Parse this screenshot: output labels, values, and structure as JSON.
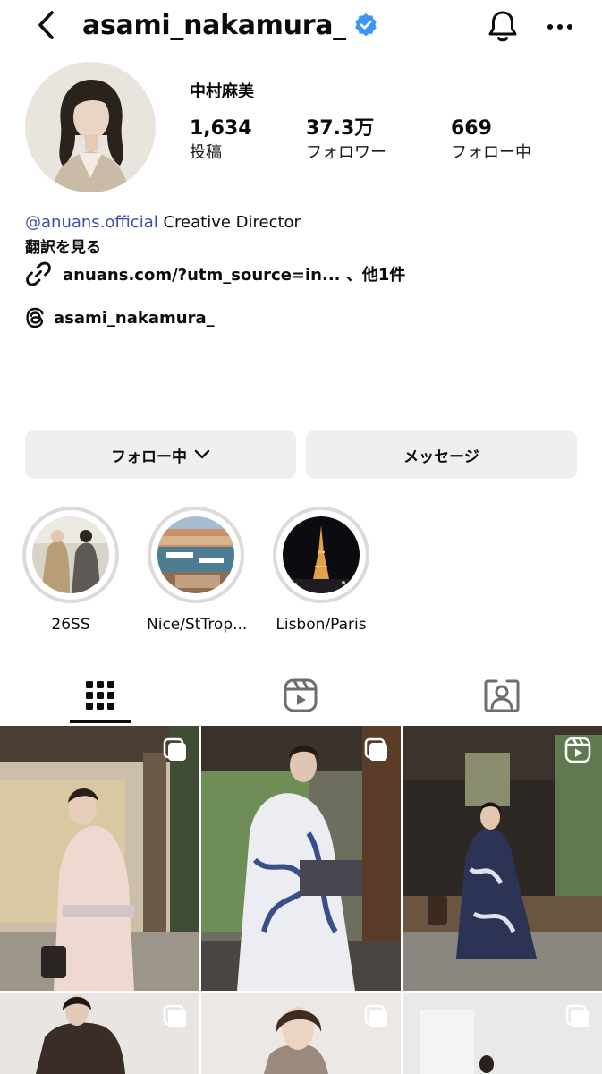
{
  "header": {
    "username": "asami_nakamura_",
    "verified": true,
    "icons": {
      "back": "chevron-left-icon",
      "verified": "verified-badge-icon",
      "notifications": "bell-icon",
      "more": "more-horizontal-icon"
    }
  },
  "profile": {
    "display_name": "中村麻美",
    "stats": {
      "posts": {
        "value": "1,634",
        "label": "投稿"
      },
      "followers": {
        "value": "37.3万",
        "label": "フォロワー"
      },
      "following": {
        "value": "669",
        "label": "フォロー中"
      }
    },
    "bio": {
      "mention": "@anuans.official",
      "text": " Creative Director"
    },
    "translate_label": "翻訳を見る",
    "link": {
      "text": "anuans.com/?utm_source=in...",
      "more": " 、他1件"
    },
    "threads_handle": "asami_nakamura_"
  },
  "actions": {
    "following_label": "フォロー中",
    "message_label": "メッセージ"
  },
  "highlights": [
    {
      "label": "26SS"
    },
    {
      "label": "Nice/StTrop..."
    },
    {
      "label": "Lisbon/Paris"
    }
  ],
  "tabs": [
    {
      "name": "posts",
      "icon": "grid-icon",
      "active": true
    },
    {
      "name": "reels",
      "icon": "reels-icon",
      "active": false
    },
    {
      "name": "tagged",
      "icon": "tagged-icon",
      "active": false
    }
  ],
  "grid": [
    {
      "type": "carousel",
      "badge_icon": "carousel-icon"
    },
    {
      "type": "carousel",
      "badge_icon": "carousel-icon"
    },
    {
      "type": "reel",
      "badge_icon": "reel-icon"
    },
    {
      "type": "carousel",
      "badge_icon": "carousel-icon"
    },
    {
      "type": "carousel",
      "badge_icon": "carousel-icon"
    },
    {
      "type": "carousel",
      "badge_icon": "carousel-icon"
    }
  ],
  "colors": {
    "mention": "#3d4fa8",
    "verified": "#3b95f6",
    "button_bg": "#efefef",
    "ring": "#dbdbdb"
  }
}
